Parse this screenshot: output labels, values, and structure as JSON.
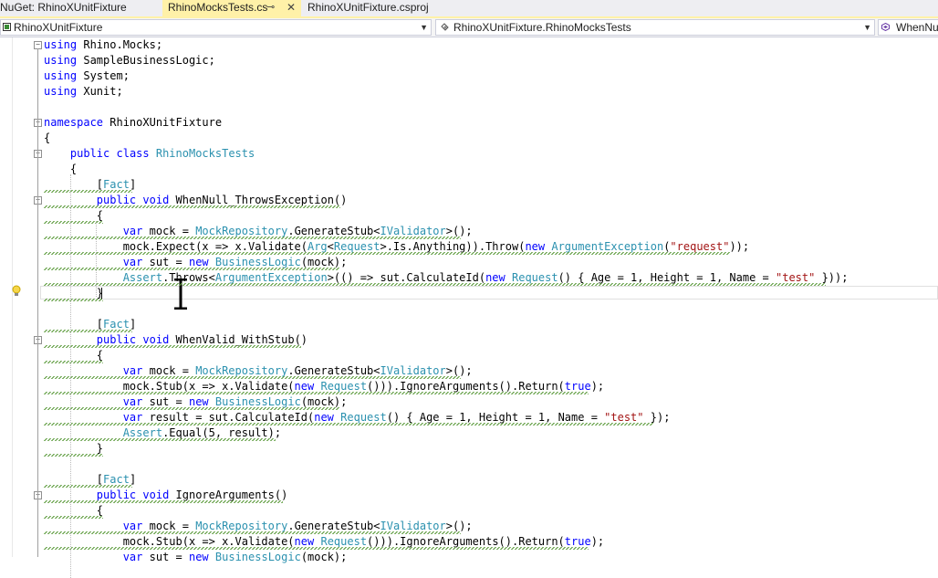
{
  "tabs": [
    {
      "label": "NuGet: RhinoXUnitFixture",
      "active": false
    },
    {
      "label": "RhinoMocksTests.cs",
      "active": true,
      "pin": "⊸",
      "close": "✕"
    },
    {
      "label": "RhinoXUnitFixture.csproj",
      "active": false
    }
  ],
  "navbar": {
    "project": "RhinoXUnitFixture",
    "type": "RhinoXUnitFixture.RhinoMocksTests",
    "member": "WhenNu"
  },
  "colors": {
    "keyword": "#0000ff",
    "type": "#2b91af",
    "string": "#a31515",
    "active_tab": "#fff1a8"
  },
  "icons": [
    "csharp-project-icon",
    "class-icon",
    "method-icon",
    "lightbulb-icon",
    "text-cursor-icon"
  ],
  "code": {
    "l0": [
      [
        "kw",
        "using"
      ],
      [
        "t",
        " Rhino.Mocks;"
      ]
    ],
    "l1": [
      [
        "kw",
        "using"
      ],
      [
        "t",
        " SampleBusinessLogic;"
      ]
    ],
    "l2": [
      [
        "kw",
        "using"
      ],
      [
        "t",
        " System;"
      ]
    ],
    "l3": [
      [
        "kw",
        "using"
      ],
      [
        "t",
        " Xunit;"
      ]
    ],
    "l5": [
      [
        "kw",
        "namespace"
      ],
      [
        "t",
        " RhinoXUnitFixture"
      ]
    ],
    "l6": [
      [
        "t",
        "{"
      ]
    ],
    "l7": [
      [
        "t",
        "    "
      ],
      [
        "kw",
        "public"
      ],
      [
        "t",
        " "
      ],
      [
        "kw",
        "class"
      ],
      [
        "t",
        " "
      ],
      [
        "ty",
        "RhinoMocksTests"
      ]
    ],
    "l8": [
      [
        "t",
        "    {"
      ]
    ],
    "l9": [
      [
        "t",
        "        ["
      ],
      [
        "ty",
        "Fact"
      ],
      [
        "t",
        "]"
      ]
    ],
    "l10": [
      [
        "t",
        "        "
      ],
      [
        "kw",
        "public"
      ],
      [
        "t",
        " "
      ],
      [
        "kw",
        "void"
      ],
      [
        "t",
        " WhenNull_ThrowsException()"
      ]
    ],
    "l11": [
      [
        "t",
        "        {"
      ]
    ],
    "l12": [
      [
        "t",
        "            "
      ],
      [
        "kw",
        "var"
      ],
      [
        "t",
        " mock = "
      ],
      [
        "ty",
        "MockRepository"
      ],
      [
        "t",
        ".GenerateStub<"
      ],
      [
        "ty",
        "IValidator"
      ],
      [
        "t",
        ">();"
      ]
    ],
    "l13": [
      [
        "t",
        "            mock.Expect(x => x.Validate("
      ],
      [
        "ty",
        "Arg"
      ],
      [
        "t",
        "<"
      ],
      [
        "ty",
        "Request"
      ],
      [
        "t",
        ">.Is.Anything)).Throw("
      ],
      [
        "kw",
        "new"
      ],
      [
        "t",
        " "
      ],
      [
        "ty",
        "ArgumentException"
      ],
      [
        "t",
        "("
      ],
      [
        "st",
        "\"request\""
      ],
      [
        "t",
        "));"
      ]
    ],
    "l14": [
      [
        "t",
        "            "
      ],
      [
        "kw",
        "var"
      ],
      [
        "t",
        " sut = "
      ],
      [
        "kw",
        "new"
      ],
      [
        "t",
        " "
      ],
      [
        "ty",
        "BusinessLogic"
      ],
      [
        "t",
        "(mock);"
      ]
    ],
    "l15": [
      [
        "t",
        "            "
      ],
      [
        "ty",
        "Assert"
      ],
      [
        "t",
        ".Throws<"
      ],
      [
        "ty",
        "ArgumentException"
      ],
      [
        "t",
        ">(() => sut.CalculateId("
      ],
      [
        "kw",
        "new"
      ],
      [
        "t",
        " "
      ],
      [
        "ty",
        "Request"
      ],
      [
        "t",
        "() { Age = 1, Height = 1, Name = "
      ],
      [
        "st",
        "\"test\""
      ],
      [
        "t",
        " }));"
      ]
    ],
    "l16": [
      [
        "t",
        "        }"
      ]
    ],
    "l18": [
      [
        "t",
        "        ["
      ],
      [
        "ty",
        "Fact"
      ],
      [
        "t",
        "]"
      ]
    ],
    "l19": [
      [
        "t",
        "        "
      ],
      [
        "kw",
        "public"
      ],
      [
        "t",
        " "
      ],
      [
        "kw",
        "void"
      ],
      [
        "t",
        " WhenValid_WithStub()"
      ]
    ],
    "l20": [
      [
        "t",
        "        {"
      ]
    ],
    "l21": [
      [
        "t",
        "            "
      ],
      [
        "kw",
        "var"
      ],
      [
        "t",
        " mock = "
      ],
      [
        "ty",
        "MockRepository"
      ],
      [
        "t",
        ".GenerateStub<"
      ],
      [
        "ty",
        "IValidator"
      ],
      [
        "t",
        ">();"
      ]
    ],
    "l22": [
      [
        "t",
        "            mock.Stub(x => x.Validate("
      ],
      [
        "kw",
        "new"
      ],
      [
        "t",
        " "
      ],
      [
        "ty",
        "Request"
      ],
      [
        "t",
        "())).IgnoreArguments().Return("
      ],
      [
        "kw",
        "true"
      ],
      [
        "t",
        ");"
      ]
    ],
    "l23": [
      [
        "t",
        "            "
      ],
      [
        "kw",
        "var"
      ],
      [
        "t",
        " sut = "
      ],
      [
        "kw",
        "new"
      ],
      [
        "t",
        " "
      ],
      [
        "ty",
        "BusinessLogic"
      ],
      [
        "t",
        "(mock);"
      ]
    ],
    "l24": [
      [
        "t",
        "            "
      ],
      [
        "kw",
        "var"
      ],
      [
        "t",
        " result = sut.CalculateId("
      ],
      [
        "kw",
        "new"
      ],
      [
        "t",
        " "
      ],
      [
        "ty",
        "Request"
      ],
      [
        "t",
        "() { Age = 1, Height = 1, Name = "
      ],
      [
        "st",
        "\"test\""
      ],
      [
        "t",
        " });"
      ]
    ],
    "l25": [
      [
        "t",
        "            "
      ],
      [
        "ty",
        "Assert"
      ],
      [
        "t",
        ".Equal(5, result);"
      ]
    ],
    "l26": [
      [
        "t",
        "        }"
      ]
    ],
    "l28": [
      [
        "t",
        "        ["
      ],
      [
        "ty",
        "Fact"
      ],
      [
        "t",
        "]"
      ]
    ],
    "l29": [
      [
        "t",
        "        "
      ],
      [
        "kw",
        "public"
      ],
      [
        "t",
        " "
      ],
      [
        "kw",
        "void"
      ],
      [
        "t",
        " IgnoreArguments()"
      ]
    ],
    "l30": [
      [
        "t",
        "        {"
      ]
    ],
    "l31": [
      [
        "t",
        "            "
      ],
      [
        "kw",
        "var"
      ],
      [
        "t",
        " mock = "
      ],
      [
        "ty",
        "MockRepository"
      ],
      [
        "t",
        ".GenerateStub<"
      ],
      [
        "ty",
        "IValidator"
      ],
      [
        "t",
        ">();"
      ]
    ],
    "l32": [
      [
        "t",
        "            mock.Stub(x => x.Validate("
      ],
      [
        "kw",
        "new"
      ],
      [
        "t",
        " "
      ],
      [
        "ty",
        "Request"
      ],
      [
        "t",
        "())).IgnoreArguments().Return("
      ],
      [
        "kw",
        "true"
      ],
      [
        "t",
        ");"
      ]
    ],
    "l33": [
      [
        "t",
        "            "
      ],
      [
        "kw",
        "var"
      ],
      [
        "t",
        " sut = "
      ],
      [
        "kw",
        "new"
      ],
      [
        "t",
        " "
      ],
      [
        "ty",
        "BusinessLogic"
      ],
      [
        "t",
        "(mock);"
      ]
    ]
  }
}
